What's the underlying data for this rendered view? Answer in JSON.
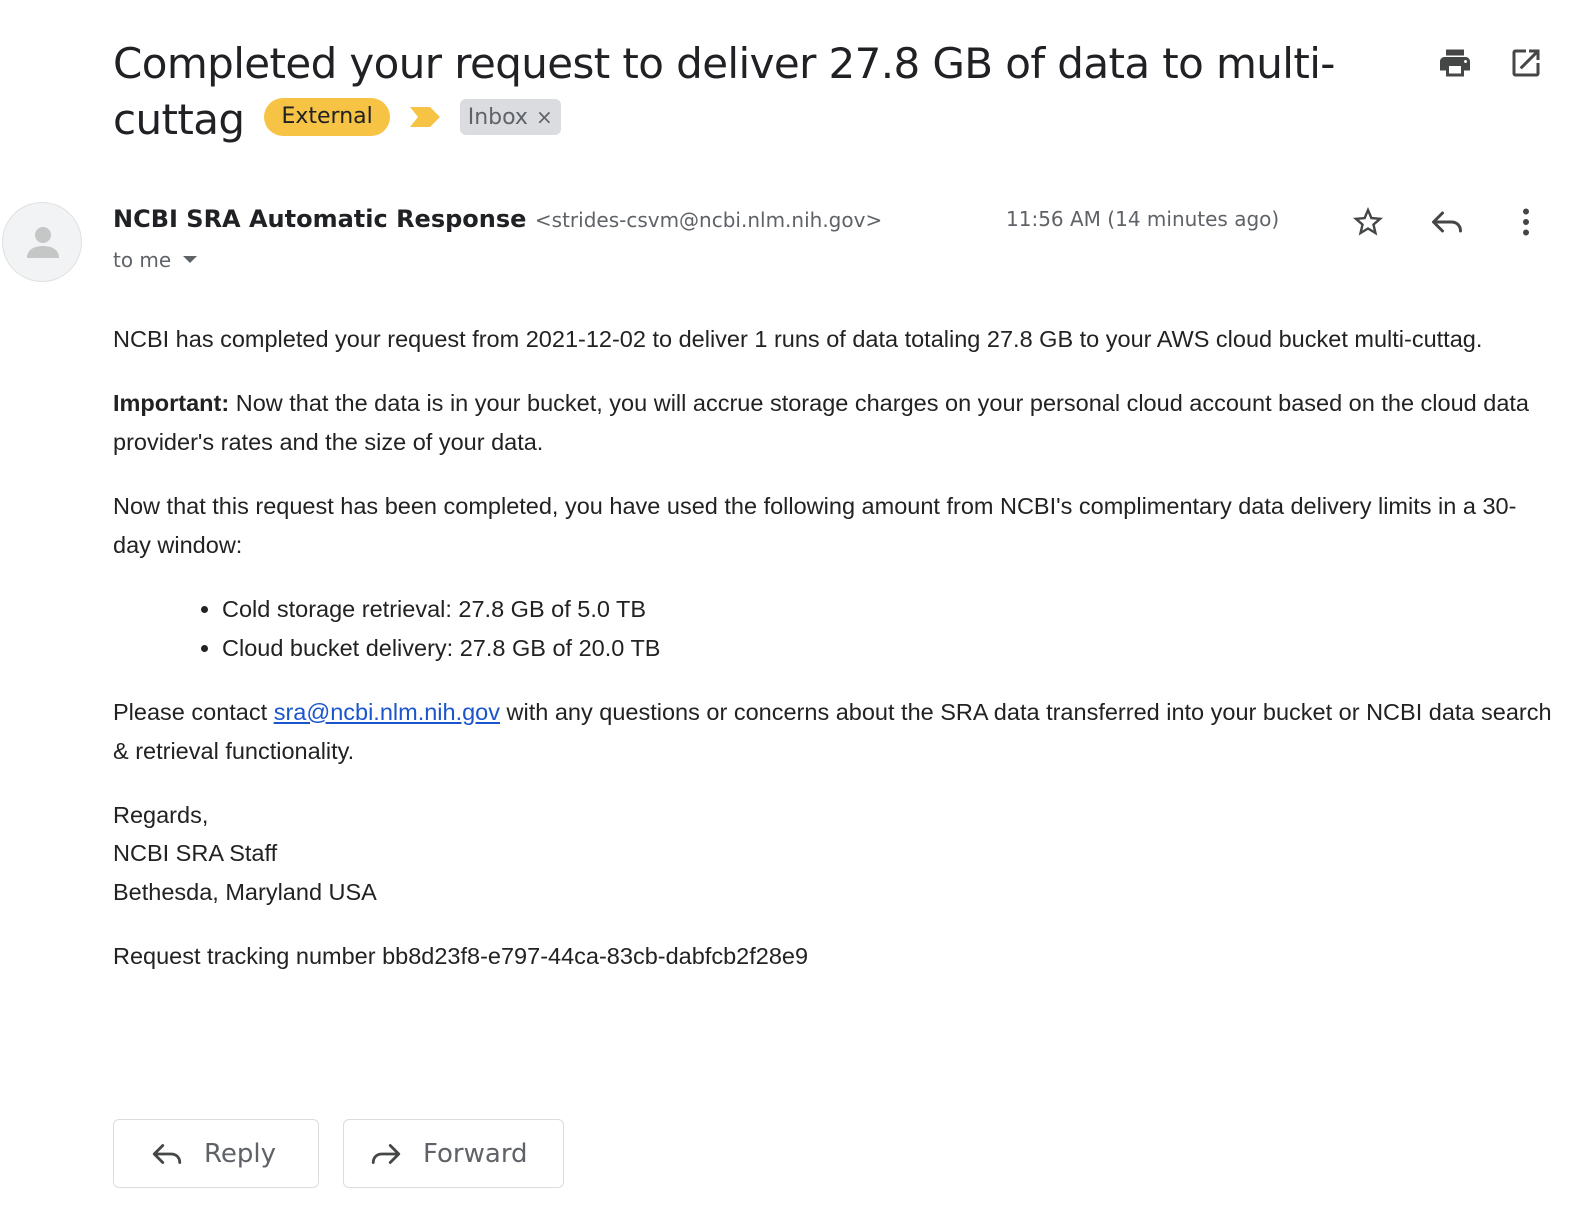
{
  "email": {
    "subject": "Completed your request to deliver 27.8 GB of data to multi-cuttag",
    "labels": {
      "external": "External",
      "inbox": "Inbox",
      "remove": "×"
    },
    "top_actions": [
      "print-icon",
      "open-in-new-window-icon"
    ],
    "sender": {
      "name": "NCBI SRA Automatic Response",
      "email": "<strides-csvm@ncbi.nlm.nih.gov>",
      "recipient": "to me",
      "timestamp": "11:56 AM (14 minutes ago)"
    },
    "header_actions": [
      "star-icon",
      "reply-icon",
      "more-vert-icon"
    ],
    "body": {
      "p1": "NCBI has completed your request from 2021-12-02 to deliver 1 runs of data totaling 27.8 GB to your AWS cloud bucket multi-cuttag.",
      "p2_bold": "Important:",
      "p2_rest": " Now that the data is in your bucket, you will accrue storage charges on your personal cloud account based on the cloud data provider's rates and the size of your data.",
      "p3": "Now that this request has been completed, you have used the following amount from NCBI's complimentary data delivery limits in a 30-day window:",
      "limits": [
        "Cold storage retrieval: 27.8 GB of 5.0 TB",
        "Cloud bucket delivery: 27.8 GB of 20.0 TB"
      ],
      "p4_before": "Please contact ",
      "p4_link": "sra@ncbi.nlm.nih.gov",
      "p4_after": " with any questions or concerns about the SRA data transferred into your bucket or NCBI data search & retrieval functionality.",
      "regards": "Regards,",
      "staff": "NCBI SRA Staff",
      "location": "Bethesda, Maryland USA",
      "tracking": "Request tracking number bb8d23f8-e797-44ca-83cb-dabfcb2f28e9"
    },
    "buttons": {
      "reply": "Reply",
      "forward": "Forward"
    }
  },
  "colors": {
    "external_label": "#f6c344",
    "inbox_label": "#dadce0",
    "link": "#1a55cc"
  }
}
